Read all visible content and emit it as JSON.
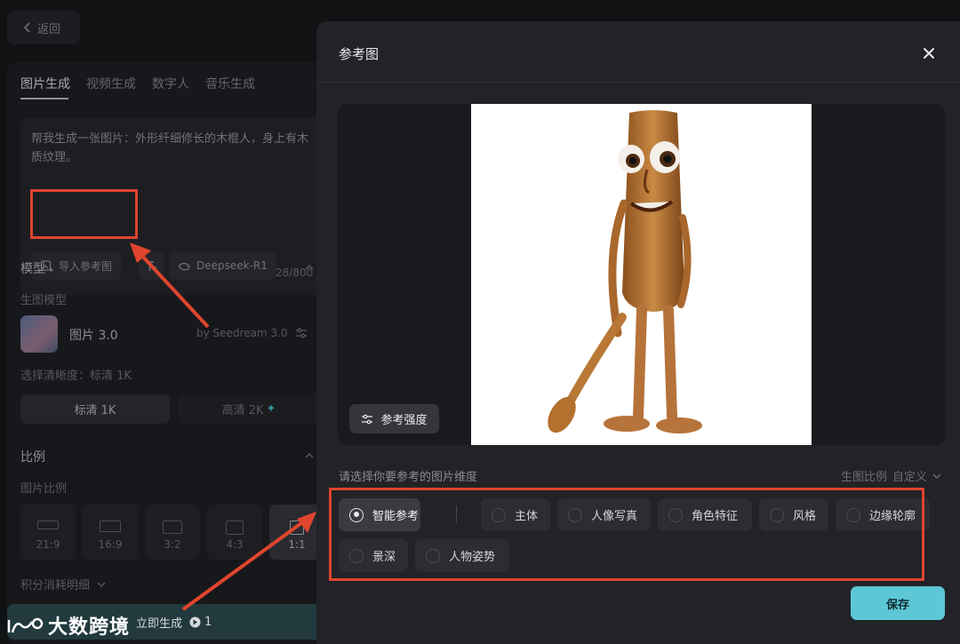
{
  "back": {
    "label": "返回"
  },
  "tabs": [
    "图片生成",
    "视频生成",
    "数字人",
    "音乐生成"
  ],
  "prompt": {
    "text": "帮我生成一张图片：外形纤细修长的木棍人，身上有木质纹理。",
    "import_ref_label": "导入参考图",
    "model_chip": "Deepseek-R1",
    "counter": "28/800"
  },
  "model_section": {
    "title": "模型",
    "sub_label": "生图模型",
    "model_name": "图片 3.0",
    "model_by": "by Seedream 3.0",
    "resolution_label": "选择清晰度：标清 1K",
    "res_std": "标清 1K",
    "res_hd": "高清 2K"
  },
  "ratio_section": {
    "title": "比例",
    "sub_label": "图片比例",
    "ratios": [
      "21:9",
      "16:9",
      "3:2",
      "4:3",
      "1:1"
    ]
  },
  "credits_label": "积分消耗明细",
  "generate": {
    "label": "立即生成",
    "cost": "1"
  },
  "modal": {
    "title": "参考图",
    "strength_label": "参考强度",
    "dimension_prompt": "请选择你要参考的图片维度",
    "ratio_label": "生图比例",
    "ratio_value": "自定义",
    "options_row1": [
      "智能参考",
      "主体",
      "人像写真",
      "角色特征",
      "风格",
      "边缘轮廓"
    ],
    "options_row2": [
      "景深",
      "人物姿势"
    ],
    "selected_option": "智能参考",
    "save_label": "保存"
  },
  "watermark": "大数跨境",
  "colors": {
    "accent": "#5dc7d6",
    "annotation": "#e0452e",
    "modal_bg": "#222327"
  }
}
